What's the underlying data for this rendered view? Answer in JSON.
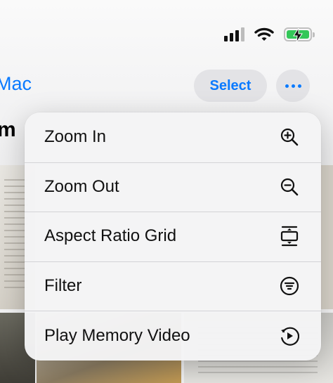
{
  "nav": {
    "back_label": "Mac",
    "select_label": "Select",
    "more_icon": "ellipsis-icon",
    "title_fragment": "m"
  },
  "status_bar": {
    "icons": [
      "cellular-signal-icon",
      "wifi-icon",
      "battery-charging-icon"
    ],
    "battery_color": "#34c759"
  },
  "menu": {
    "items": [
      {
        "label": "Zoom In",
        "icon": "zoom-in-icon"
      },
      {
        "label": "Zoom Out",
        "icon": "zoom-out-icon"
      },
      {
        "label": "Aspect Ratio Grid",
        "icon": "aspect-ratio-icon"
      },
      {
        "label": "Filter",
        "icon": "filter-icon"
      },
      {
        "label": "Play Memory Video",
        "icon": "play-memory-icon"
      }
    ]
  },
  "colors": {
    "accent": "#0a7aff",
    "menu_background": "#f4f4f5",
    "separator": "#d3d3d6"
  }
}
